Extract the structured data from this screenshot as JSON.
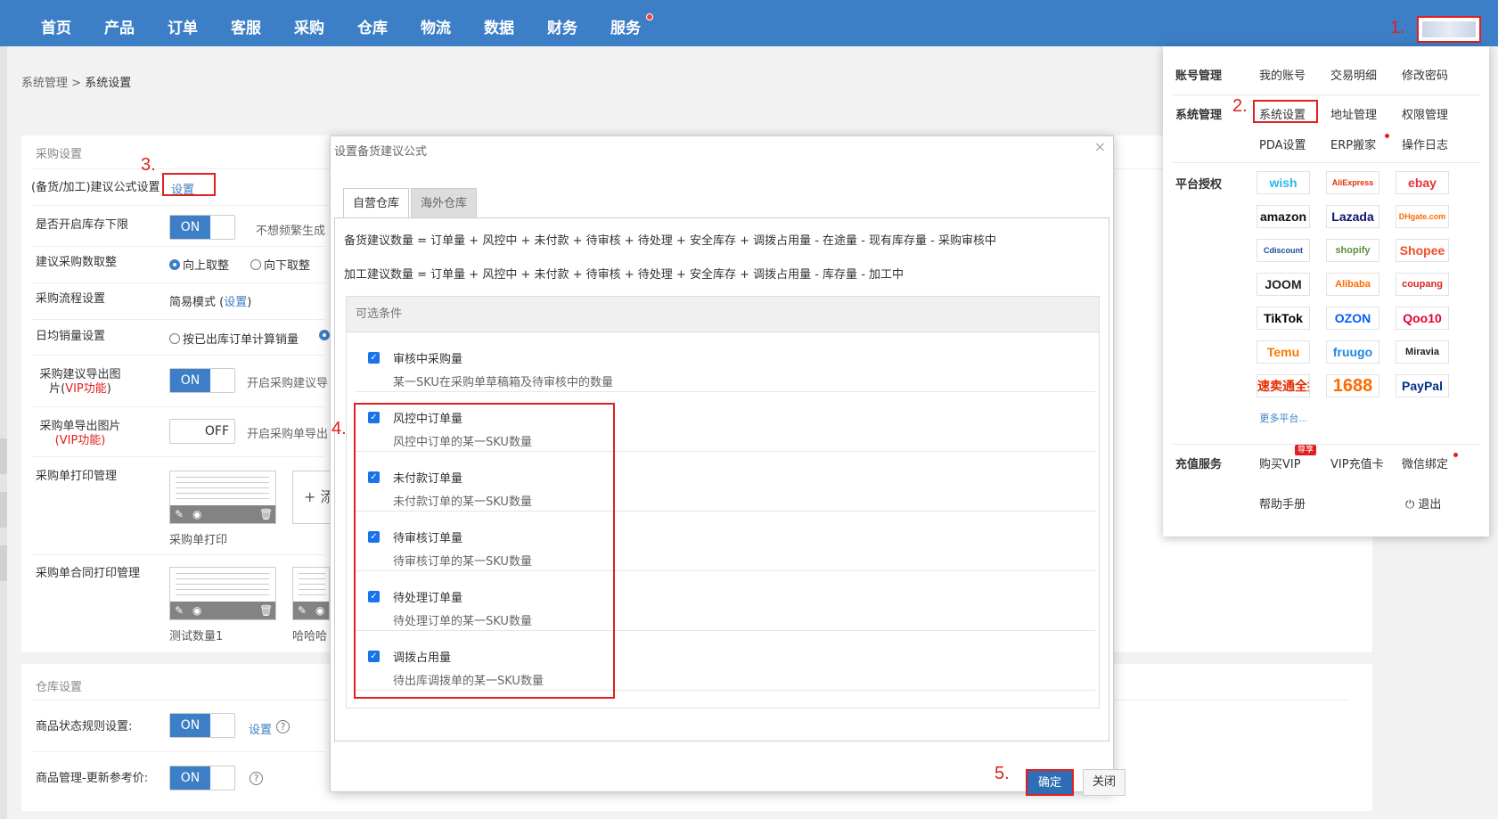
{
  "nav": {
    "items": [
      "首页",
      "产品",
      "订单",
      "客服",
      "采购",
      "仓库",
      "物流",
      "数据",
      "财务",
      "服务"
    ]
  },
  "markers": [
    "1.",
    "2.",
    "3.",
    "4.",
    "5."
  ],
  "breadcrumb": {
    "parent": "系统管理",
    "sep": ">",
    "current": "系统设置"
  },
  "purchase_settings": {
    "section_title": "采购设置",
    "formula_label": "(备货/加工)建议公式设置",
    "formula_link": "设置",
    "min_stock_label": "是否开启库存下限",
    "min_stock_toggle": "ON",
    "min_stock_hint": "不想频繁生成",
    "rounding_label": "建议采购数取整",
    "rounding_up": "向上取整",
    "rounding_down": "向下取整",
    "flow_label": "采购流程设置",
    "flow_value": "简易模式 (",
    "flow_link": "设置",
    "flow_close": ")",
    "daily_sales_label": "日均销量设置",
    "daily_sales_option": "按已出库订单计算销量",
    "export_img_label_1": "采购建议导出图",
    "export_img_label_2a": "片(",
    "export_img_vip": "VIP功能",
    "export_img_label_2b": ")",
    "export_img_toggle": "ON",
    "export_img_hint": "开启采购建议导",
    "order_img_label": "采购单导出图片",
    "order_img_vip": "(VIP功能)",
    "order_img_toggle": "OFF",
    "order_img_hint": "开启采购单导出",
    "print_label": "采购单打印管理",
    "print_thumb_caption": "采购单打印",
    "print_add": "+ 添",
    "contract_label": "采购单合同打印管理",
    "contract_thumb_caption_1": "测试数量1",
    "contract_thumb_caption_2": "哈哈哈"
  },
  "warehouse_settings": {
    "section_title": "仓库设置",
    "status_rule_label": "商品状态规则设置:",
    "status_rule_toggle": "ON",
    "status_rule_link": "设置",
    "ref_price_label": "商品管理-更新参考价:",
    "ref_price_toggle": "ON",
    "help_glyph": "?"
  },
  "dropdown": {
    "account_cat": "账号管理",
    "account_items": [
      "我的账号",
      "交易明细",
      "修改密码"
    ],
    "system_cat": "系统管理",
    "system_items": [
      "系统设置",
      "地址管理",
      "权限管理",
      "PDA设置",
      "ERP搬家",
      "操作日志"
    ],
    "platform_cat": "平台授权",
    "platforms": [
      "wish",
      "AliExpress",
      "ebay",
      "amazon",
      "Lazada",
      "DHgate.com",
      "Cdiscount",
      "shopify",
      "Shopee",
      "JOOM",
      "Alibaba",
      "coupang",
      "TikTok",
      "OZON",
      "Qoo10",
      "Temu",
      "fruugo",
      "Miravia",
      "速卖通全托管",
      "1688",
      "PayPal",
      "更多平台..."
    ],
    "platform_colors": {
      "wish": "#2fb7ec",
      "AliExpress": "#e62e04",
      "ebay": "#e53238",
      "amazon": "#111111",
      "Lazada": "#0f146d",
      "DHgate.com": "#ff6a00",
      "Cdiscount": "#1a4a9c",
      "shopify": "#5e8e3e",
      "Shopee": "#ee4d2d",
      "JOOM": "#222222",
      "Alibaba": "#ff6a00",
      "coupang": "#d6262b",
      "TikTok": "#000000",
      "OZON": "#005bff",
      "Qoo10": "#e6002d",
      "Temu": "#fb7701",
      "fruugo": "#1e88e5",
      "Miravia": "#222222",
      "速卖通全托管": "#e62e04",
      "1688": "#ff6a00",
      "PayPal": "#003087",
      "更多平台...": "#3d7fc6"
    },
    "value_cat": "充值服务",
    "value_items": [
      "购买VIP",
      "VIP充值卡",
      "微信绑定"
    ],
    "vip_badge": "尊享",
    "help": "帮助手册",
    "logout": "退出"
  },
  "modal": {
    "title": "设置备货建议公式",
    "close_glyph": "×",
    "tabs": [
      "自营仓库",
      "海外仓库"
    ],
    "formula_1": "备货建议数量 = 订单量 + 风控中 + 未付款 + 待审核 + 待处理 + 安全库存 + 调拨占用量 - 在途量 - 现有库存量 - 采购审核中",
    "formula_2": "加工建议数量 = 订单量 + 风控中 + 未付款 + 待审核 + 待处理 + 安全库存 + 调拨占用量 - 库存量 - 加工中",
    "conditions_header": "可选条件",
    "conditions": [
      {
        "name": "审核中采购量",
        "desc": "某一SKU在采购单草稿箱及待审核中的数量",
        "checked": true
      },
      {
        "name": "风控中订单量",
        "desc": "风控中订单的某一SKU数量",
        "checked": true
      },
      {
        "name": "未付款订单量",
        "desc": "未付款订单的某一SKU数量",
        "checked": true
      },
      {
        "name": "待审核订单量",
        "desc": "待审核订单的某一SKU数量",
        "checked": true
      },
      {
        "name": "待处理订单量",
        "desc": "待处理订单的某一SKU数量",
        "checked": true
      },
      {
        "name": "调拨占用量",
        "desc": "待出库调拨单的某一SKU数量",
        "checked": true
      }
    ],
    "confirm": "确定",
    "close": "关闭"
  },
  "colors": {
    "primary": "#3d7fc6",
    "highlight": "#e02020",
    "checkbox": "#1a73e8"
  }
}
